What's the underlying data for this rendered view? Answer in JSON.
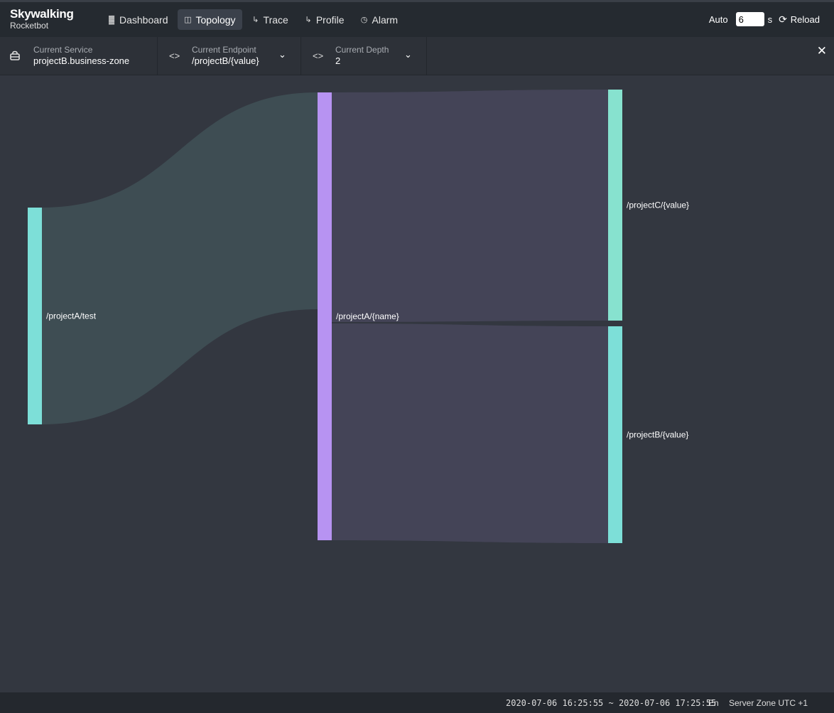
{
  "app": {
    "brand": "Skywalking",
    "product": "Rocketbot"
  },
  "nav": {
    "items": [
      {
        "label": "Dashboard",
        "icon": "chart-icon"
      },
      {
        "label": "Topology",
        "icon": "topology-icon"
      },
      {
        "label": "Trace",
        "icon": "trace-icon"
      },
      {
        "label": "Profile",
        "icon": "profile-icon"
      },
      {
        "label": "Alarm",
        "icon": "alarm-icon"
      }
    ],
    "active": "Topology"
  },
  "toolbar_right": {
    "auto_label": "Auto",
    "interval_value": "6",
    "unit": "s",
    "reload_label": "Reload"
  },
  "selectors": {
    "service": {
      "label": "Current Service",
      "value": "projectB.business-zone"
    },
    "endpoint": {
      "label": "Current Endpoint",
      "value": "/projectB/{value}"
    },
    "depth": {
      "label": "Current Depth",
      "value": "2"
    }
  },
  "colors": {
    "teal": "#7ddfd8",
    "purple": "#b793f2",
    "teal_link": "#3e4d53",
    "purple_link": "#444457",
    "background": "#333740"
  },
  "chart_data": {
    "type": "sankey",
    "nodes": [
      {
        "name": "/projectA/test",
        "color": "#7ddfd8"
      },
      {
        "name": "/projectA/{name}",
        "color": "#b793f2"
      },
      {
        "name": "/projectC/{value}",
        "color": "#87e2cf"
      },
      {
        "name": "/projectB/{value}",
        "color": "#7ddfd8"
      }
    ],
    "links": [
      {
        "source": "/projectA/test",
        "target": "/projectA/{name}",
        "value": 1
      },
      {
        "source": "/projectA/{name}",
        "target": "/projectC/{value}",
        "value": 1
      },
      {
        "source": "/projectA/{name}",
        "target": "/projectB/{value}",
        "value": 1
      }
    ]
  },
  "footer": {
    "time_range": "2020-07-06 16:25:55 ~ 2020-07-06 17:25:55",
    "language": "En",
    "server_zone": "Server Zone UTC +1"
  }
}
